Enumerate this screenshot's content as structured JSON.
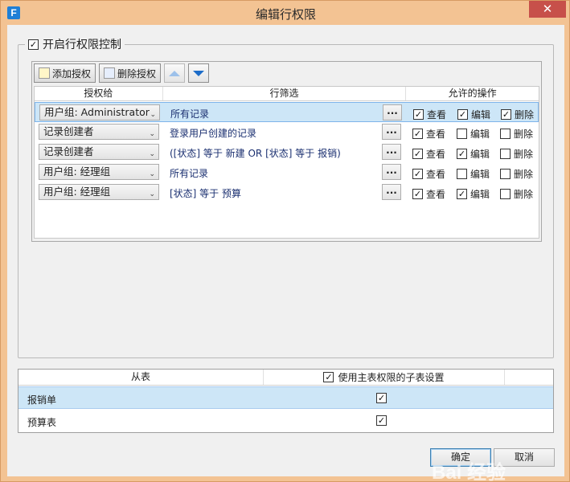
{
  "window": {
    "title": "编辑行权限",
    "close_label": "✕",
    "app_icon": "F"
  },
  "group": {
    "enable_label": "开启行权限控制",
    "enabled": true
  },
  "toolbar": {
    "add_label": "添加授权",
    "delete_label": "删除授权"
  },
  "grid": {
    "headers": [
      "授权给",
      "行筛选",
      "允许的操作"
    ],
    "rows": [
      {
        "grantee": "用户组: Administrator",
        "filter": "所有记录",
        "view": true,
        "edit": true,
        "delete": true,
        "selected": true
      },
      {
        "grantee": "记录创建者",
        "filter": "登录用户创建的记录",
        "view": true,
        "edit": false,
        "delete": false,
        "selected": false
      },
      {
        "grantee": "记录创建者",
        "filter": "([状态] 等于 新建 OR [状态] 等于 报销)",
        "view": true,
        "edit": true,
        "delete": false,
        "selected": false
      },
      {
        "grantee": "用户组: 经理组",
        "filter": "所有记录",
        "view": true,
        "edit": false,
        "delete": false,
        "selected": false
      },
      {
        "grantee": "用户组: 经理组",
        "filter": "[状态] 等于 预算",
        "view": true,
        "edit": true,
        "delete": false,
        "selected": false
      }
    ],
    "ellipsis": "...",
    "op_labels": {
      "view": "查看",
      "edit": "编辑",
      "delete": "删除"
    }
  },
  "subtable": {
    "header_name": "从表",
    "header_use_master": "使用主表权限的子表设置",
    "header_checked": true,
    "rows": [
      {
        "name": "报销单",
        "checked": true,
        "selected": true
      },
      {
        "name": "预算表",
        "checked": true,
        "selected": false
      }
    ]
  },
  "buttons": {
    "ok": "确定",
    "cancel": "取消"
  },
  "watermark": "Bai 经验",
  "colors": {
    "selection": "#cde6f7",
    "frame": "#f3c393",
    "close": "#c7504a",
    "accent": "#1c6cc8"
  }
}
